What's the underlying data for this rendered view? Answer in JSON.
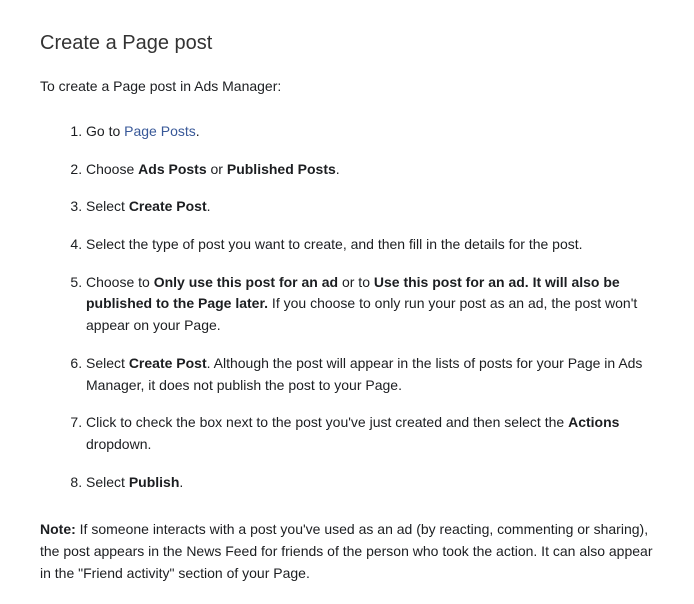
{
  "heading": "Create a Page post",
  "intro": "To create a Page post in Ads Manager:",
  "step1": {
    "prefix": "Go to ",
    "link": "Page Posts",
    "suffix": "."
  },
  "step2": {
    "prefix": "Choose ",
    "bold1": "Ads Posts",
    "mid": " or ",
    "bold2": "Published Posts",
    "suffix": "."
  },
  "step3": {
    "prefix": "Select ",
    "bold1": "Create Post",
    "suffix": "."
  },
  "step4": {
    "text": "Select the type of post you want to create, and then fill in the details for the post."
  },
  "step5": {
    "prefix": "Choose to ",
    "bold1": "Only use this post for an ad",
    "mid": " or to ",
    "bold2": "Use this post for an ad. It will also be published to the Page later.",
    "suffix": " If you choose to only run your post as an ad, the post won't appear on your Page."
  },
  "step6": {
    "prefix": "Select ",
    "bold1": "Create Post",
    "suffix": ". Although the post will appear in the lists of posts for your Page in Ads Manager, it does not publish the post to your Page."
  },
  "step7": {
    "prefix": "Click to check the box next to the post you've just created and then select the ",
    "bold1": "Actions",
    "suffix": " dropdown."
  },
  "step8": {
    "prefix": "Select ",
    "bold1": "Publish",
    "suffix": "."
  },
  "note": {
    "boldlabel": "Note:",
    "text": " If someone interacts with a post you've used as an ad (by reacting, commenting or sharing), the post appears in the News Feed for friends of the person who took the action. It can also appear in the \"Friend activity\" section of your Page."
  }
}
